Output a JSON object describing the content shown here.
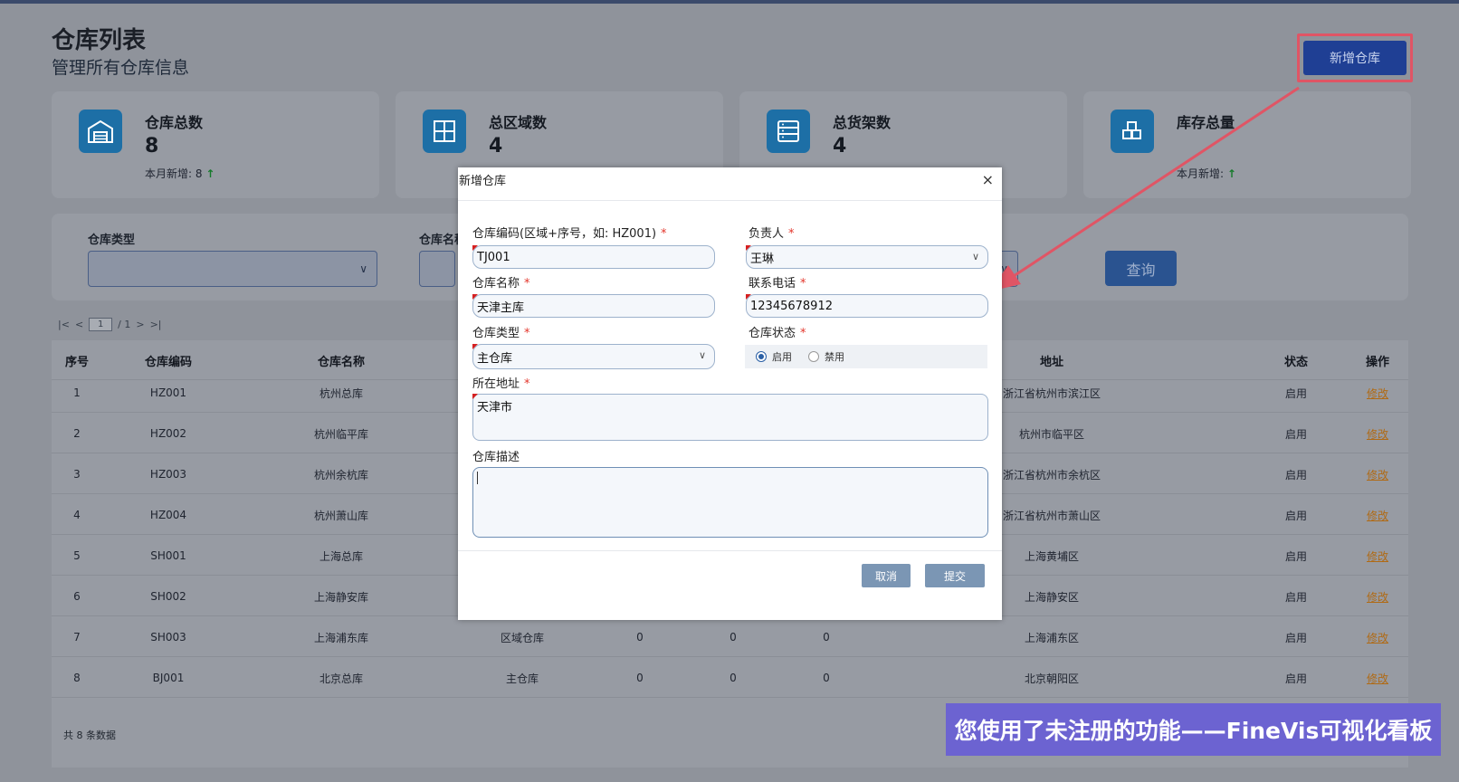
{
  "page": {
    "title": "仓库列表",
    "subtitle": "管理所有仓库信息",
    "add_button": "新增仓库"
  },
  "stats": [
    {
      "title": "仓库总数",
      "value": "8",
      "note": "本月新增: 8",
      "icon": "warehouse-icon"
    },
    {
      "title": "总区域数",
      "value": "4",
      "note": "",
      "icon": "grid-icon"
    },
    {
      "title": "总货架数",
      "value": "4",
      "note": "",
      "icon": "shelf-icon"
    },
    {
      "title": "库存总量",
      "value": "",
      "note": "本月新增:",
      "icon": "boxes-icon"
    }
  ],
  "filter": {
    "type_label": "仓库类型",
    "name_label": "仓库名称",
    "query_button": "查询"
  },
  "pager": {
    "current": "1",
    "total": "/ 1"
  },
  "table": {
    "columns": [
      "序号",
      "仓库编码",
      "仓库名称",
      "地址",
      "状态",
      "操作"
    ],
    "rows": [
      {
        "no": "1",
        "code": "HZ001",
        "name": "杭州总库",
        "type": "",
        "c1": "",
        "c2": "",
        "c3": "",
        "addr": "浙江省杭州市滨江区",
        "status": "启用",
        "action": "修改"
      },
      {
        "no": "2",
        "code": "HZ002",
        "name": "杭州临平库",
        "type": "",
        "c1": "",
        "c2": "",
        "c3": "",
        "addr": "杭州市临平区",
        "status": "启用",
        "action": "修改"
      },
      {
        "no": "3",
        "code": "HZ003",
        "name": "杭州余杭库",
        "type": "",
        "c1": "",
        "c2": "",
        "c3": "",
        "addr": "浙江省杭州市余杭区",
        "status": "启用",
        "action": "修改"
      },
      {
        "no": "4",
        "code": "HZ004",
        "name": "杭州萧山库",
        "type": "",
        "c1": "",
        "c2": "",
        "c3": "",
        "addr": "浙江省杭州市萧山区",
        "status": "启用",
        "action": "修改"
      },
      {
        "no": "5",
        "code": "SH001",
        "name": "上海总库",
        "type": "",
        "c1": "",
        "c2": "",
        "c3": "",
        "addr": "上海黄埔区",
        "status": "启用",
        "action": "修改"
      },
      {
        "no": "6",
        "code": "SH002",
        "name": "上海静安库",
        "type": "",
        "c1": "",
        "c2": "",
        "c3": "",
        "addr": "上海静安区",
        "status": "启用",
        "action": "修改"
      },
      {
        "no": "7",
        "code": "SH003",
        "name": "上海浦东库",
        "type": "区域仓库",
        "c1": "0",
        "c2": "0",
        "c3": "0",
        "addr": "上海浦东区",
        "status": "启用",
        "action": "修改"
      },
      {
        "no": "8",
        "code": "BJ001",
        "name": "北京总库",
        "type": "主仓库",
        "c1": "0",
        "c2": "0",
        "c3": "0",
        "addr": "北京朝阳区",
        "status": "启用",
        "action": "修改"
      }
    ],
    "total_text": "共 8 条数据"
  },
  "modal": {
    "title": "新增仓库",
    "close": "×",
    "code_label": "仓库编码(区域+序号，如: HZ001)",
    "code_value": "TJ001",
    "owner_label": "负责人",
    "owner_value": "王琳",
    "name_label": "仓库名称",
    "name_value": "天津主库",
    "phone_label": "联系电话",
    "phone_value": "12345678912",
    "type_label": "仓库类型",
    "type_value": "主仓库",
    "status_label": "仓库状态",
    "status_on": "启用",
    "status_off": "禁用",
    "status_selected": "启用",
    "addr_label": "所在地址",
    "addr_value": "天津市",
    "desc_label": "仓库描述",
    "desc_value": "",
    "required_mark": "*",
    "cancel": "取消",
    "submit": "提交"
  },
  "watermark": "您使用了未注册的功能——FineVis可视化看板",
  "colors": {
    "accent": "#1f3f94",
    "annotation": "#e05565",
    "required": "#e3352b",
    "watermark_bg": "#6c63d1"
  }
}
